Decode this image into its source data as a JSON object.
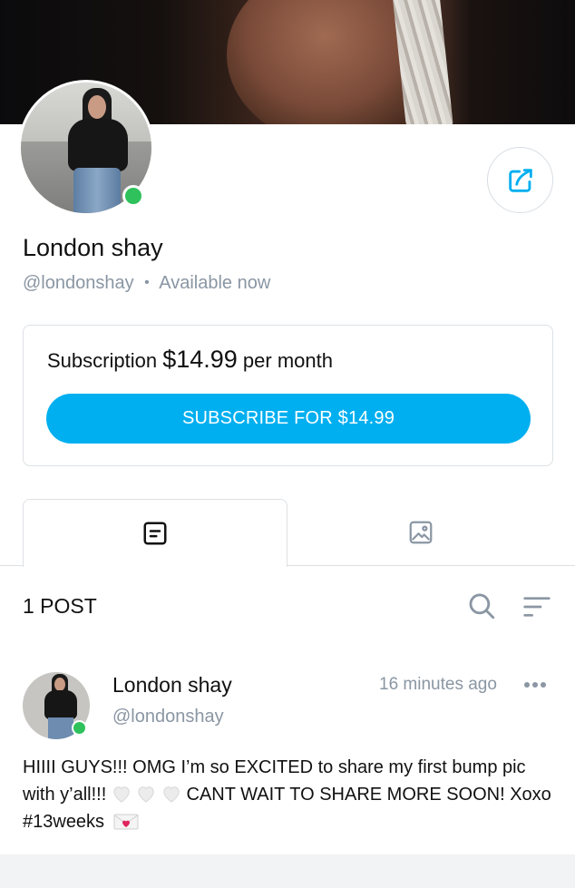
{
  "profile": {
    "name": "London shay",
    "handle": "@londonshay",
    "separator": "•",
    "status": "Available now"
  },
  "subscription": {
    "label": "Subscription",
    "price": "$14.99",
    "period": "per month",
    "button_label": "SUBSCRIBE FOR $14.99"
  },
  "tabs": [
    {
      "name": "posts",
      "icon": "posts-icon",
      "active": true
    },
    {
      "name": "media",
      "icon": "image-icon",
      "active": false
    }
  ],
  "feed": {
    "count_label": "1 POST"
  },
  "post": {
    "author": "London shay",
    "handle": "@londonshay",
    "time": "16 minutes ago",
    "text_part1": "HIIII GUYS!!! OMG I’m so EXCITED to share my first bump pic with y’all!!! ",
    "text_part2": " CANT WAIT TO SHARE MORE SOON! Xoxo #13weeks",
    "emoji": [
      "white-heart",
      "white-heart",
      "white-heart",
      "love-letter"
    ]
  },
  "colors": {
    "accent": "#00aff0",
    "online": "#2fc15b",
    "muted": "#8a96a3"
  }
}
